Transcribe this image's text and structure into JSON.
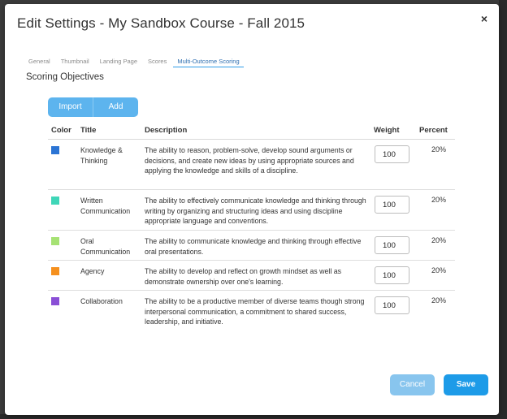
{
  "dialog": {
    "title": "Edit Settings - My Sandbox Course - Fall 2015",
    "close_glyph": "×"
  },
  "tabs": [
    {
      "label": "General",
      "active": false
    },
    {
      "label": "Thumbnail",
      "active": false
    },
    {
      "label": "Landing Page",
      "active": false
    },
    {
      "label": "Scores",
      "active": false
    },
    {
      "label": "Multi-Outcome Scoring",
      "active": true
    }
  ],
  "section_title": "Scoring Objectives",
  "toolbar": {
    "import_label": "Import",
    "add_label": "Add"
  },
  "table": {
    "headers": {
      "color": "Color",
      "title": "Title",
      "description": "Description",
      "weight": "Weight",
      "percent": "Percent"
    },
    "rows": [
      {
        "color": "#2b74d4",
        "title": "Knowledge & Thinking",
        "description": "The ability to reason, problem-solve, develop sound arguments or decisions, and create new ideas by using appropriate sources and applying the knowledge and skills of a discipline.",
        "weight": "100",
        "percent": "20%"
      },
      {
        "color": "#3fd6b8",
        "title": "Written Communication",
        "description": "The ability to effectively communicate knowledge and thinking through writing by organizing and structuring ideas and using discipline appropriate language and conventions.",
        "weight": "100",
        "percent": "20%"
      },
      {
        "color": "#a6e274",
        "title": "Oral Communication",
        "description": "The ability to communicate knowledge and thinking through effective oral presentations.",
        "weight": "100",
        "percent": "20%"
      },
      {
        "color": "#f5901e",
        "title": "Agency",
        "description": "The ability to develop and reflect on growth mindset as well as demonstrate ownership over one's learning.",
        "weight": "100",
        "percent": "20%"
      },
      {
        "color": "#8a4fd6",
        "title": "Collaboration",
        "description": "The ability to be a productive member of diverse teams though strong interpersonal communication, a commitment to shared success, leadership, and initiative.",
        "weight": "100",
        "percent": "20%"
      }
    ]
  },
  "footer": {
    "cancel_label": "Cancel",
    "save_label": "Save"
  }
}
